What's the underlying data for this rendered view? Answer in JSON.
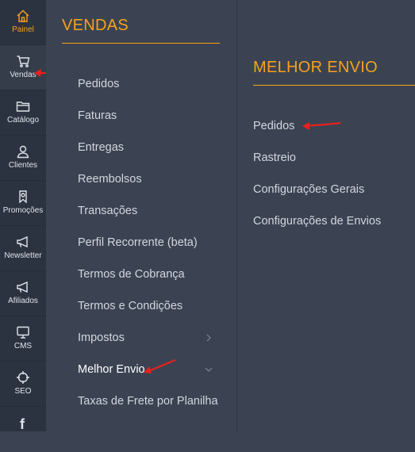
{
  "rail": {
    "items": [
      {
        "label": "Painel",
        "icon": "home-icon"
      },
      {
        "label": "Vendas",
        "icon": "cart-icon"
      },
      {
        "label": "Catálogo",
        "icon": "folder-icon"
      },
      {
        "label": "Clientes",
        "icon": "user-icon"
      },
      {
        "label": "Promoções",
        "icon": "ribbon-icon"
      },
      {
        "label": "Newsletter",
        "icon": "megaphone-icon"
      },
      {
        "label": "Afiliados",
        "icon": "megaphone-icon"
      },
      {
        "label": "CMS",
        "icon": "monitor-icon"
      },
      {
        "label": "SEO",
        "icon": "crosshair-icon"
      },
      {
        "label": "",
        "icon": "facebook-icon"
      }
    ]
  },
  "vendas": {
    "title": "VENDAS",
    "items": [
      {
        "label": "Pedidos"
      },
      {
        "label": "Faturas"
      },
      {
        "label": "Entregas"
      },
      {
        "label": "Reembolsos"
      },
      {
        "label": "Transações"
      },
      {
        "label": "Perfil Recorrente (beta)"
      },
      {
        "label": "Termos de Cobrança"
      },
      {
        "label": "Termos e Condições"
      },
      {
        "label": "Impostos"
      },
      {
        "label": "Melhor Envio"
      },
      {
        "label": "Taxas de Frete por Planilha"
      }
    ]
  },
  "melhor_envio": {
    "title": "MELHOR ENVIO",
    "items": [
      {
        "label": "Pedidos"
      },
      {
        "label": "Rastreio"
      },
      {
        "label": "Configurações Gerais"
      },
      {
        "label": "Configurações de Envios"
      }
    ]
  },
  "colors": {
    "accent": "#f7a21b",
    "annotation_arrow": "#e8201e",
    "rail_bg": "#2c3340",
    "panel_bg": "#3b4352"
  }
}
